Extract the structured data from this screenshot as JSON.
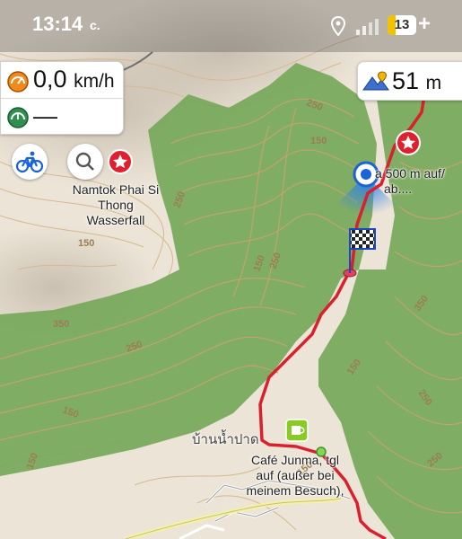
{
  "status_bar": {
    "time": "13:14",
    "carrier_glyph": "c.",
    "battery_level": "13",
    "charging_glyph": "+",
    "icons": [
      "location-icon",
      "signal-icon",
      "battery-icon"
    ]
  },
  "speed_widget": {
    "speed_value": "0,0",
    "speed_unit": "km/h",
    "max_speed_value": "—"
  },
  "altitude_widget": {
    "value": "51",
    "unit": "m"
  },
  "map": {
    "contour_labels": [
      "250",
      "150",
      "250",
      "150",
      "350",
      "250",
      "150",
      "250",
      "150",
      "350",
      "250",
      "150",
      "250",
      "150",
      "150"
    ],
    "poi_waterfall": "Namtok Phai Si Thong Wasserfall",
    "poi_waterfall_lines": [
      "Namtok Phai Si",
      "Thong",
      "Wasserfall"
    ],
    "route_note_lines": [
      "a 500 m auf/",
      "ab...."
    ],
    "village_name": "บ้านน้ำปาด",
    "cafe_lines": [
      "Café Junma, tgl",
      "auf (außer bei",
      "meinem Besuch),"
    ],
    "colors": {
      "forest": "#76a85a",
      "land": "#ece4d6",
      "route": "#d9202c",
      "contour": "#c9a26f",
      "water_road": "#2b7ff0"
    }
  }
}
